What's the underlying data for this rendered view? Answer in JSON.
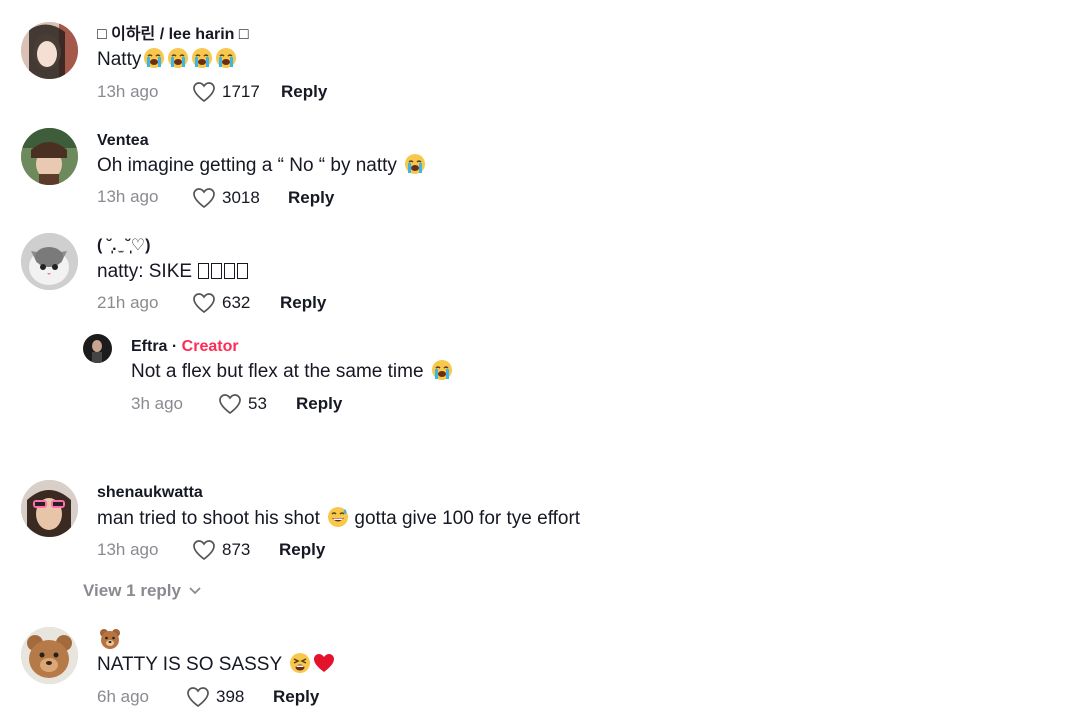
{
  "comments": [
    {
      "username": "□ 이하린 / lee harin □",
      "text": "Natty",
      "emojis": [
        "crying-face",
        "crying-face",
        "crying-face",
        "crying-face"
      ],
      "time": "13h ago",
      "likes": "1717",
      "reply_label": "Reply"
    },
    {
      "username": "Ventea",
      "text": "Oh imagine getting a “ No “ by natty",
      "emojis": [
        "crying-face"
      ],
      "time": "13h ago",
      "likes": "3018",
      "reply_label": "Reply"
    },
    {
      "username": "( ˘̩̩̩. ̫ ˘̩̩̩♡)",
      "text": "natty: SIKE ",
      "time": "21h ago",
      "likes": "632",
      "reply_label": "Reply"
    },
    {
      "username": "Eftra",
      "separator": " · ",
      "badge": "Creator",
      "text": "Not a flex but flex at the same time",
      "emojis": [
        "crying-face"
      ],
      "time": "3h ago",
      "likes": "53",
      "reply_label": "Reply"
    },
    {
      "username": "shenaukwatta",
      "text_before": "man tried to shoot his shot",
      "text_after": "gotta give 100 for tye effort",
      "emojis": [
        "grinning-sweat-face"
      ],
      "time": "13h ago",
      "likes": "873",
      "reply_label": "Reply"
    },
    {
      "username": "",
      "username_emoji": "bear-face",
      "text": "NATTY IS SO SASSY",
      "emojis": [
        "tired-face",
        "red-heart"
      ],
      "time": "6h ago",
      "likes": "398",
      "reply_label": "Reply"
    }
  ],
  "view_replies_label": "View 1 reply",
  "colors": {
    "creator": "#fe2c55",
    "muted": "#8a8b91",
    "text": "#161823"
  }
}
